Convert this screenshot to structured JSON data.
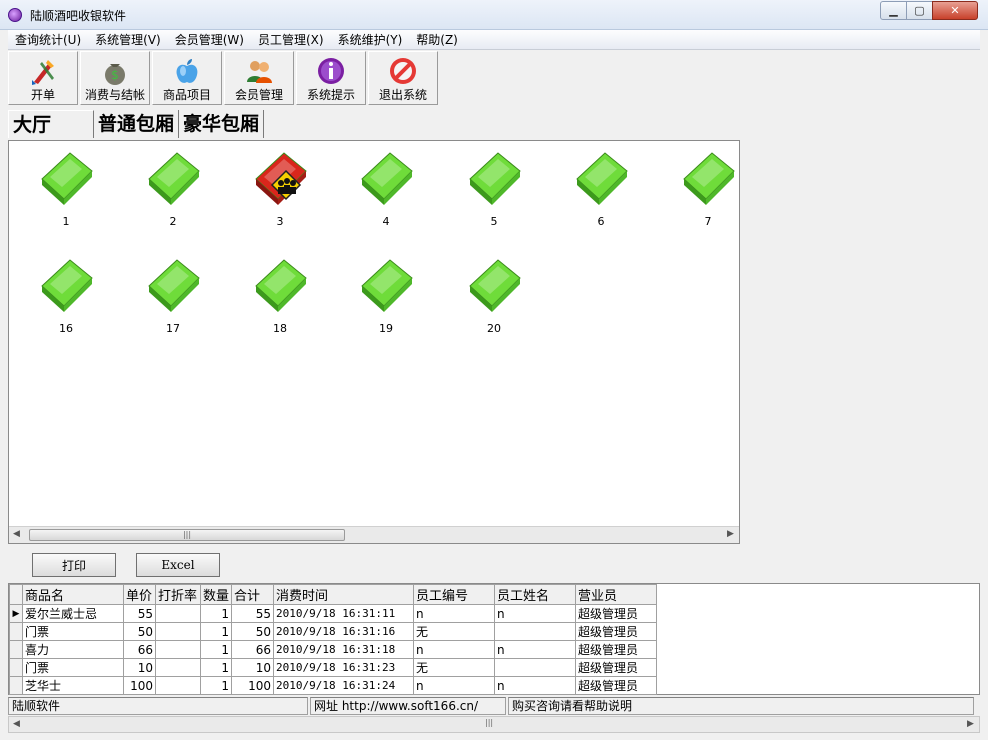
{
  "window": {
    "title": "陆顺酒吧收银软件",
    "min_icon": "minimize-icon",
    "max_icon": "maximize-icon",
    "close_icon": "close-icon"
  },
  "menu": [
    "查询统计(U)",
    "系统管理(V)",
    "会员管理(W)",
    "员工管理(X)",
    "系统维护(Y)",
    "帮助(Z)"
  ],
  "toolbar": [
    {
      "label": "开单",
      "icon": "paintbrush-icon"
    },
    {
      "label": "消费与结帐",
      "icon": "money-bag-icon"
    },
    {
      "label": "商品项目",
      "icon": "apple-icon"
    },
    {
      "label": "会员管理",
      "icon": "users-icon"
    },
    {
      "label": "系统提示",
      "icon": "info-icon"
    },
    {
      "label": "退出系统",
      "icon": "no-entry-icon"
    }
  ],
  "tabs": [
    "大厅",
    "普通包厢",
    "豪华包厢"
  ],
  "active_tab": "大厅",
  "rooms": [
    {
      "num": "1",
      "status": "free"
    },
    {
      "num": "2",
      "status": "free"
    },
    {
      "num": "3",
      "status": "occupied"
    },
    {
      "num": "4",
      "status": "free"
    },
    {
      "num": "5",
      "status": "free"
    },
    {
      "num": "6",
      "status": "free"
    },
    {
      "num": "7",
      "status": "free"
    },
    {
      "num": "16",
      "status": "free"
    },
    {
      "num": "17",
      "status": "free"
    },
    {
      "num": "18",
      "status": "free"
    },
    {
      "num": "19",
      "status": "free"
    },
    {
      "num": "20",
      "status": "free"
    }
  ],
  "colors": {
    "free": "#6fdc3a",
    "occupied": "#d9261c",
    "occupied_badge": "#f5d000"
  },
  "actions": {
    "print": "打印",
    "excel": "Excel"
  },
  "grid": {
    "columns": [
      "商品名",
      "单价",
      "打折率",
      "数量",
      "合计",
      "消费时间",
      "员工编号",
      "员工姓名",
      "营业员"
    ],
    "rows": [
      [
        "爱尔兰威士忌",
        "55",
        "",
        "1",
        "55",
        "2010/9/18 16:31:11",
        "n",
        "n",
        "超级管理员"
      ],
      [
        "门票",
        "50",
        "",
        "1",
        "50",
        "2010/9/18 16:31:16",
        "无",
        "",
        "超级管理员"
      ],
      [
        "喜力",
        "66",
        "",
        "1",
        "66",
        "2010/9/18 16:31:18",
        "n",
        "n",
        "超级管理员"
      ],
      [
        "门票",
        "10",
        "",
        "1",
        "10",
        "2010/9/18 16:31:23",
        "无",
        "",
        "超级管理员"
      ],
      [
        "芝华士",
        "100",
        "",
        "1",
        "100",
        "2010/9/18 16:31:24",
        "n",
        "n",
        "超级管理员"
      ]
    ],
    "selected_row": 0
  },
  "status": [
    "陆顺软件",
    "网址 http://www.soft166.cn/",
    "购买咨询请看帮助说明"
  ]
}
